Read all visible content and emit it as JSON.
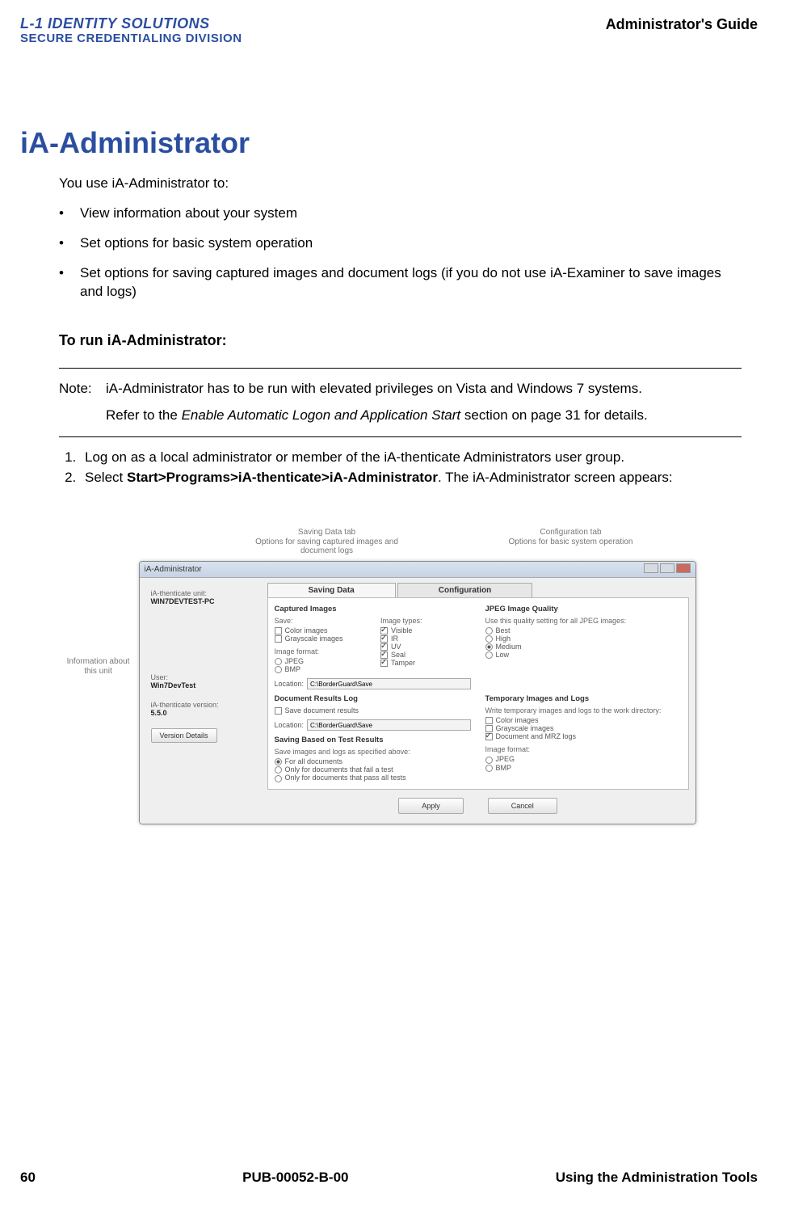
{
  "header": {
    "logo_line1": "L-1 IDENTITY SOLUTIONS",
    "logo_line2": "SECURE CREDENTIALING DIVISION",
    "guide_title": "Administrator's Guide"
  },
  "heading": "iA-Administrator",
  "intro": "You use iA-Administrator to:",
  "bullets": [
    "View information about your system",
    "Set options for basic system operation",
    "Set options for saving captured images and document logs (if you do not use iA-Examiner to save images and logs)"
  ],
  "sub_heading": "To run iA-Administrator:",
  "note": {
    "label": "Note:",
    "line1": "iA-Administrator has to be run with elevated privileges on Vista and Windows 7 systems.",
    "line2_pre": "Refer to the ",
    "line2_em": "Enable Automatic Logon and Application Start",
    "line2_post": " section on page 31 for details."
  },
  "steps": {
    "s1": "Log on as a local administrator or member of the iA-thenticate Administrators user group.",
    "s2_pre": "Select ",
    "s2_bold": "Start>Programs>iA-thenticate>iA-Administrator",
    "s2_post": ". The iA-Administrator screen appears:"
  },
  "callouts": {
    "top_left": "Saving Data tab\nOptions for saving captured images and document logs",
    "top_right": "Configuration tab\nOptions for basic system operation",
    "side": "Information about this unit"
  },
  "window": {
    "title": "iA-Administrator",
    "tabs": {
      "saving": "Saving Data",
      "config": "Configuration"
    },
    "side": {
      "unit_label": "iA-thenticate unit:",
      "unit_value": "WIN7DEVTEST-PC",
      "user_label": "User:",
      "user_value": "Win7DevTest",
      "ver_label": "iA-thenticate version:",
      "ver_value": "5.5.0",
      "ver_btn": "Version Details"
    },
    "captured": {
      "title": "Captured Images",
      "save_label": "Save:",
      "save_color": "Color images",
      "save_gray": "Grayscale images",
      "types_label": "Image types:",
      "t_visible": "Visible",
      "t_ir": "IR",
      "t_uv": "UV",
      "t_seal": "Seal",
      "t_tamper": "Tamper",
      "fmt_label": "Image format:",
      "f_jpeg": "JPEG",
      "f_bmp": "BMP",
      "loc_label": "Location:",
      "loc_val": "C:\\BorderGuard\\Save"
    },
    "jpeg": {
      "title": "JPEG Image Quality",
      "desc": "Use this quality setting for all JPEG images:",
      "q_best": "Best",
      "q_high": "High",
      "q_med": "Medium",
      "q_low": "Low"
    },
    "doclog": {
      "title": "Document Results Log",
      "save": "Save document results",
      "loc_label": "Location:",
      "loc_val": "C:\\BorderGuard\\Save"
    },
    "temp": {
      "title": "Temporary Images and Logs",
      "desc": "Write temporary images and logs to the work directory:",
      "color": "Color images",
      "gray": "Grayscale images",
      "doc": "Document and MRZ logs",
      "fmt_label": "Image format:",
      "f_jpeg": "JPEG",
      "f_bmp": "BMP"
    },
    "saving_based": {
      "title": "Saving Based on Test Results",
      "desc": "Save images and logs as specified above:",
      "r_all": "For all documents",
      "r_fail": "Only for documents that fail a test",
      "r_pass": "Only for documents that pass all tests"
    },
    "buttons": {
      "apply": "Apply",
      "cancel": "Cancel"
    }
  },
  "footer": {
    "page": "60",
    "pub": "PUB-00052-B-00",
    "section": "Using the Administration Tools"
  }
}
